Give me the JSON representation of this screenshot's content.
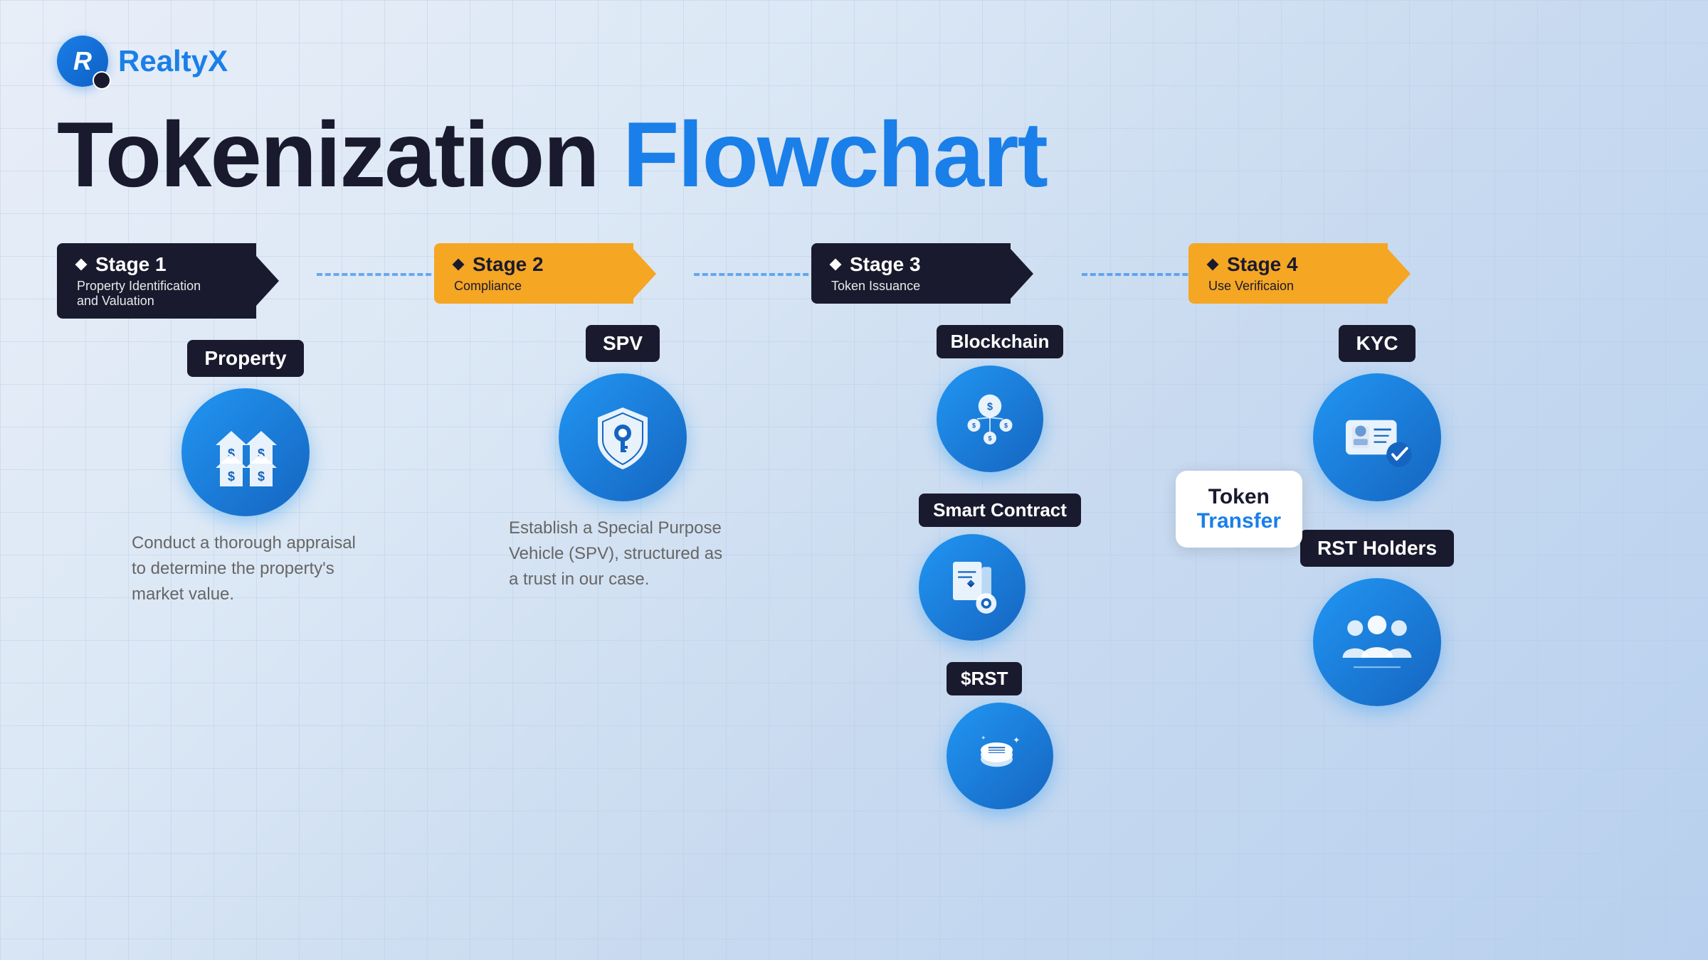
{
  "logo": {
    "letter": "R",
    "name_black": "Realty",
    "name_blue": "X"
  },
  "title": {
    "black": "Tokenization",
    "blue": "Flowchart"
  },
  "stages": [
    {
      "id": "stage1",
      "number": "Stage 1",
      "subtitle": "Property Identification and Valuation",
      "badge_color": "black",
      "items": [
        {
          "label": "Property",
          "icon": "houses-dollar",
          "description": "Conduct a thorough appraisal to determine the property's market value."
        }
      ]
    },
    {
      "id": "stage2",
      "number": "Stage 2",
      "subtitle": "Compliance",
      "badge_color": "gold",
      "items": [
        {
          "label": "SPV",
          "icon": "shield-key",
          "description": "Establish a Special Purpose Vehicle (SPV), structured as a trust in our case."
        }
      ]
    },
    {
      "id": "stage3",
      "number": "Stage 3",
      "subtitle": "Token Issuance",
      "badge_color": "black",
      "items": [
        {
          "label": "Blockchain",
          "icon": "blockchain"
        },
        {
          "label": "Smart Contract",
          "icon": "smart-contract"
        },
        {
          "label": "$RST",
          "icon": "token-coin"
        }
      ],
      "token_transfer": {
        "line1": "Token",
        "line2": "Transfer"
      }
    },
    {
      "id": "stage4",
      "number": "Stage 4",
      "subtitle": "Use Verificaion",
      "badge_color": "gold",
      "items": [
        {
          "label": "KYC",
          "icon": "kyc-card"
        },
        {
          "label": "RST Holders",
          "icon": "holders"
        }
      ]
    }
  ]
}
